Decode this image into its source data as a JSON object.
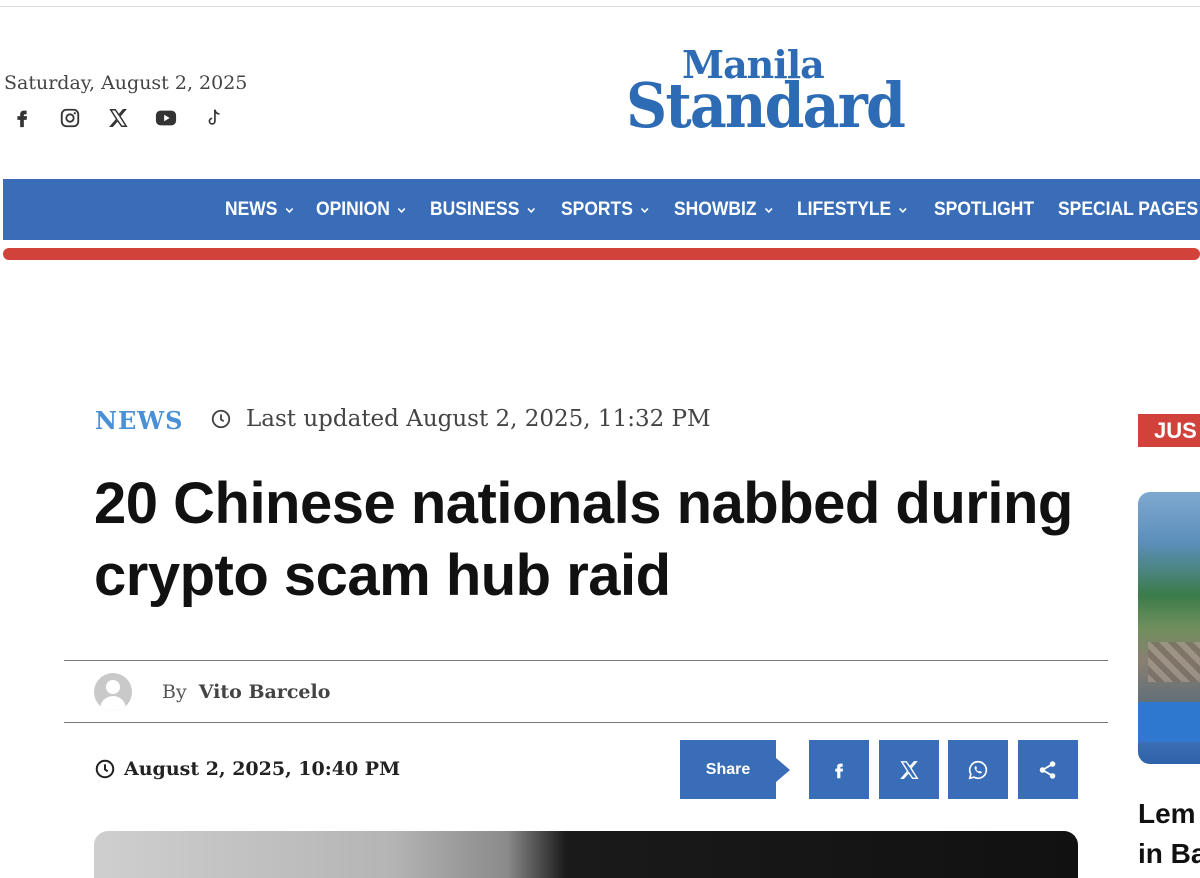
{
  "header": {
    "date": "Saturday, August 2, 2025",
    "socials": [
      {
        "icon": "facebook-icon"
      },
      {
        "icon": "instagram-icon"
      },
      {
        "icon": "x-icon"
      },
      {
        "icon": "youtube-icon"
      },
      {
        "icon": "tiktok-icon"
      }
    ],
    "logo": {
      "line1": "Manila",
      "line2": "Standard",
      "color": "#2d6cb5"
    }
  },
  "nav": {
    "color": "#3a6db7",
    "accent": "#d1423b",
    "items": [
      {
        "label": "NEWS",
        "has_dropdown": true
      },
      {
        "label": "OPINION",
        "has_dropdown": true
      },
      {
        "label": "BUSINESS",
        "has_dropdown": true
      },
      {
        "label": "SPORTS",
        "has_dropdown": true
      },
      {
        "label": "SHOWBIZ",
        "has_dropdown": true
      },
      {
        "label": "LIFESTYLE",
        "has_dropdown": true
      },
      {
        "label": "SPOTLIGHT",
        "has_dropdown": false
      },
      {
        "label": "SPECIAL PAGES",
        "has_dropdown": false
      }
    ]
  },
  "article": {
    "category": "NEWS",
    "updated": "Last updated August 2, 2025, 11:32 PM",
    "headline": "20 Chinese nationals nabbed during crypto scam hub raid",
    "byline_prefix": "By",
    "author": "Vito Barcelo",
    "published": "August 2, 2025, 10:40 PM",
    "share_label": "Share",
    "share_buttons": [
      "facebook-icon",
      "x-icon",
      "whatsapp-icon",
      "share-icon"
    ]
  },
  "sidebar": {
    "badge": "JUS",
    "title_line1": "Lem",
    "title_line2": "in Ba"
  }
}
